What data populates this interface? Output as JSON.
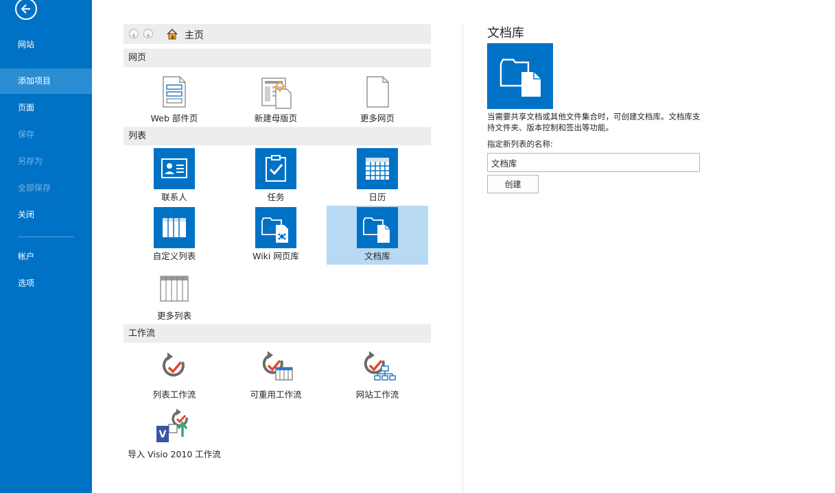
{
  "nav": {
    "site_title": "网站",
    "items": [
      {
        "label": "添加项目",
        "state": "active"
      },
      {
        "label": "页面",
        "state": "normal"
      },
      {
        "label": "保存",
        "state": "disabled"
      },
      {
        "label": "另存为",
        "state": "disabled"
      },
      {
        "label": "全部保存",
        "state": "disabled"
      },
      {
        "label": "关闭",
        "state": "normal"
      },
      {
        "label": "帐户",
        "state": "normal"
      },
      {
        "label": "选项",
        "state": "normal"
      }
    ]
  },
  "breadcrumb": {
    "home_label": "主页"
  },
  "sections": {
    "pages": {
      "header": "网页",
      "tiles": [
        "Web 部件页",
        "新建母版页",
        "更多网页"
      ]
    },
    "lists": {
      "header": "列表",
      "tiles": [
        "联系人",
        "任务",
        "日历",
        "自定义列表",
        "Wiki 网页库",
        "文档库",
        "更多列表"
      ],
      "selected": "文档库"
    },
    "workflow": {
      "header": "工作流",
      "tiles": [
        "列表工作流",
        "可重用工作流",
        "网站工作流",
        "导入 Visio 2010 工作流"
      ]
    }
  },
  "detail": {
    "title": "文档库",
    "description": "当需要共享文档或其他文件集合时，可创建文档库。文档库支持文件夹、版本控制和签出等功能。",
    "name_label": "指定新列表的名称:",
    "name_value": "文档库",
    "create_label": "创建"
  },
  "colors": {
    "accent": "#0072c6",
    "selected_tile": "#b8d9f3",
    "section_bg": "#ededed"
  }
}
